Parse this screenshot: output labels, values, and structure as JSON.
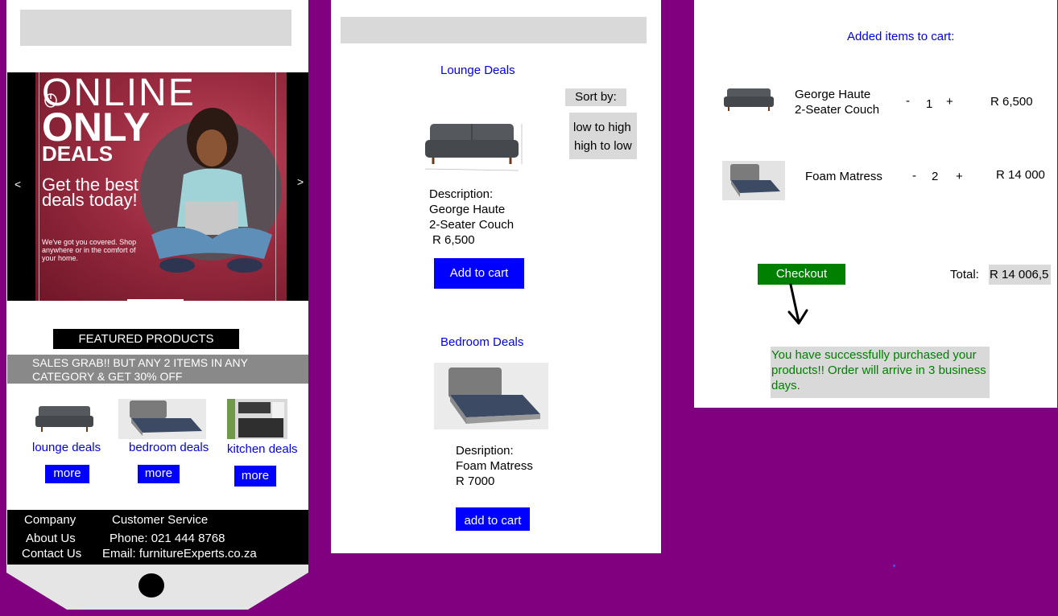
{
  "colors": {
    "background": "#80007f",
    "link_blue": "#0000ee",
    "button_blue": "#0000ff",
    "checkout_green": "#008000",
    "success_text": "#008000"
  },
  "home": {
    "banner": {
      "headline_1": "ONLINE",
      "headline_2": "ONLY",
      "headline_3": "DEALS",
      "tagline": "Get the best deals today!",
      "subtext": "We've got you covered. Shop anywhere or in the comfort of your home.",
      "prev": "<",
      "next": ">"
    },
    "featured_title": "FEATURED PRODUCTS",
    "sales_banner": "SALES GRAB!! BUT ANY 2 ITEMS IN ANY CATEGORY & GET 30% OFF",
    "categories": [
      {
        "label": "lounge deals",
        "button": "more"
      },
      {
        "label": "bedroom deals",
        "button": "more"
      },
      {
        "label": "kitchen deals",
        "button": "more"
      }
    ],
    "footer": {
      "company_heading": "Company",
      "about": "About Us",
      "contact": "Contact Us",
      "service_heading": "Customer Service",
      "phone": "Phone: 021 444 8768",
      "email": "Email: furnitureExperts.co.za"
    }
  },
  "deals": {
    "lounge_title": "Lounge Deals",
    "sort_label": "Sort by:",
    "sort_options": [
      "low to high",
      "high to low"
    ],
    "lounge_product": {
      "desc_label": "Description:",
      "name_1": "George Haute",
      "name_2": "2-Seater Couch",
      "price": "R 6,500",
      "button": "Add to cart"
    },
    "bedroom_title": "Bedroom Deals",
    "bedroom_product": {
      "desc_label": "Desription:",
      "name": "Foam Matress",
      "price": "R 7000",
      "button": "add to cart"
    }
  },
  "cart": {
    "title": "Added items to cart:",
    "items": [
      {
        "name_1": "George Haute",
        "name_2": "2-Seater Couch",
        "minus": "-",
        "qty": "1",
        "plus": "+",
        "price": "R 6,500"
      },
      {
        "name_1": "Foam Matress",
        "minus": "-",
        "qty": "2",
        "plus": "+",
        "price": "R 14 000"
      }
    ],
    "checkout_button": "Checkout",
    "total_label": "Total:",
    "total_value": "R 14 006,5",
    "success_message": "You have successfully purchased your products!! Order will arrive in 3 business days."
  }
}
